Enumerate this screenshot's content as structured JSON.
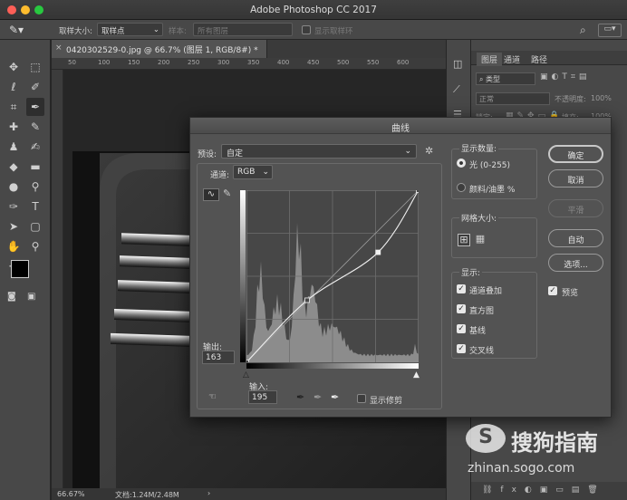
{
  "app": {
    "title": "Adobe Photoshop CC 2017"
  },
  "options_bar": {
    "sample_size_label": "取样大小:",
    "sample_size_value": "取样点",
    "sample_label": "样本:",
    "sample_value": "所有图层",
    "show_ring_label": "显示取样环"
  },
  "document": {
    "tab_title": "0420302529-0.jpg @ 66.7% (图层 1, RGB/8#) *",
    "ruler_ticks": [
      "50",
      "100",
      "150",
      "200",
      "250",
      "300",
      "350",
      "400",
      "450",
      "500",
      "550",
      "600"
    ]
  },
  "status": {
    "zoom": "66.67%",
    "doc_size": "文档:1.24M/2.48M"
  },
  "panels": {
    "tabs": [
      "图层",
      "通道",
      "路径"
    ],
    "kind_label": "类型",
    "blend_mode": "正常",
    "opacity_label": "不透明度:",
    "opacity_value": "100%",
    "lock_label": "锁定:",
    "fill_label": "填充:",
    "fill_value": "100%"
  },
  "curves": {
    "title": "曲线",
    "preset_label": "预设:",
    "preset_value": "自定",
    "channel_label": "通道:",
    "channel_value": "RGB",
    "output_label": "输出:",
    "output_value": "163",
    "input_label": "输入:",
    "input_value": "195",
    "show_clipping_label": "显示修剪",
    "display_amount_label": "显示数量:",
    "light_option": "光 (0-255)",
    "pigment_option": "颜料/油墨 %",
    "grid_size_label": "网格大小:",
    "show_label": "显示:",
    "show_options": [
      "通道叠加",
      "直方图",
      "基线",
      "交叉线"
    ],
    "buttons": {
      "ok": "确定",
      "cancel": "取消",
      "smooth": "平滑",
      "auto": "自动",
      "options": "选项..."
    },
    "preview_label": "预览",
    "curve_points": [
      [
        0,
        0
      ],
      [
        90,
        92
      ],
      [
        195,
        163
      ],
      [
        255,
        255
      ]
    ]
  },
  "watermark": {
    "brand": "搜狗指南",
    "url": "zhinan.sogo.com"
  },
  "colors": {
    "close_dot": "#fe5f57",
    "min_dot": "#febc2e",
    "max_dot": "#28c840",
    "dialog_bg": "#535353"
  }
}
